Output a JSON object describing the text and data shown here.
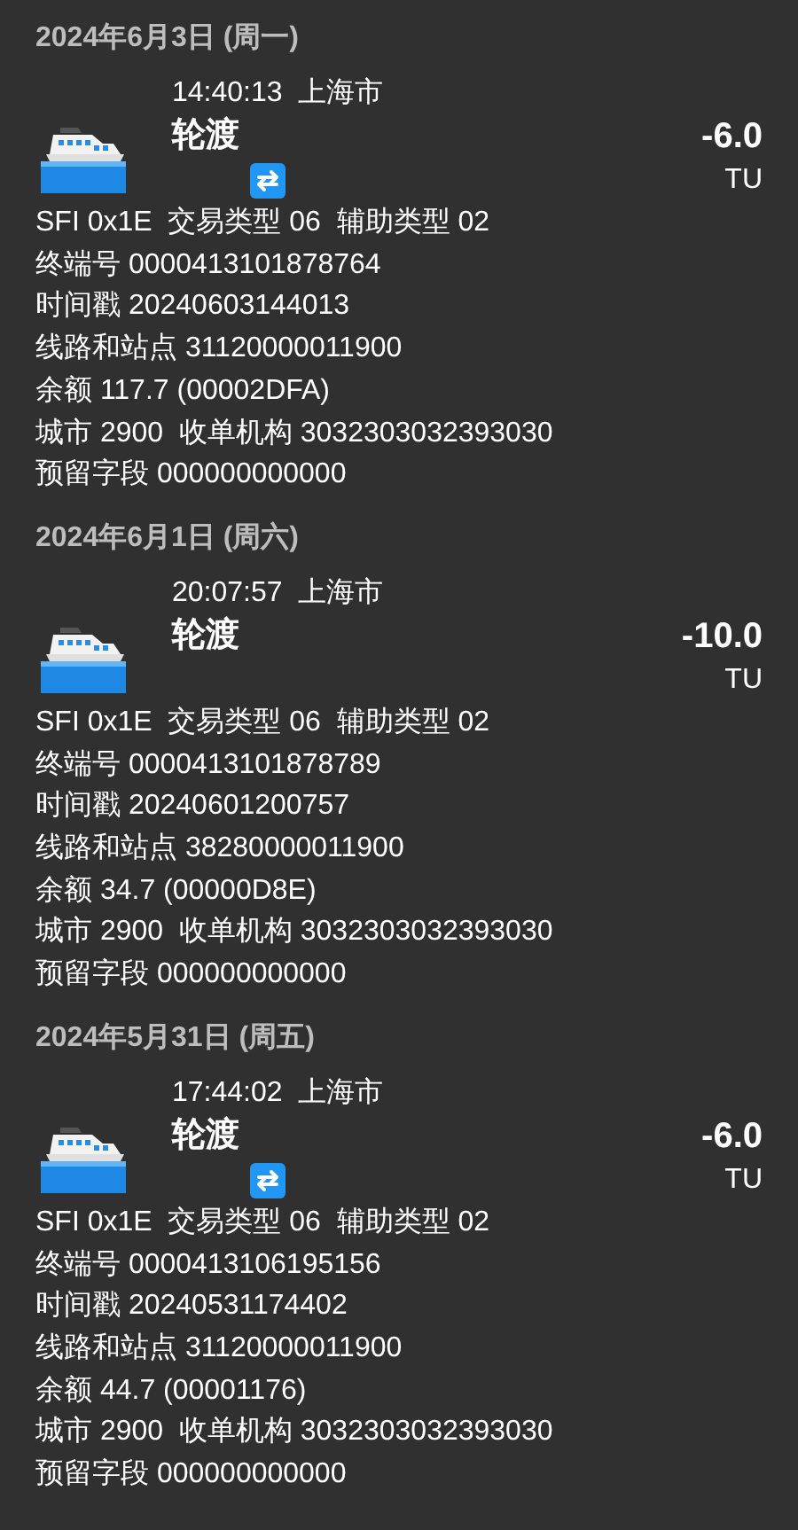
{
  "records": [
    {
      "date": "2024年6月3日 (周一)",
      "time": "14:40:13",
      "city": "上海市",
      "name": "轮渡",
      "transfer": true,
      "amount": "-6.0",
      "unit": "TU",
      "details": [
        "SFI 0x1E  交易类型 06  辅助类型 02",
        "终端号 0000413101878764",
        "时间戳 20240603144013",
        "线路和站点 31120000011900",
        "余额 117.7 (00002DFA)",
        "城市 2900  收单机构 3032303032393030",
        "预留字段 000000000000"
      ]
    },
    {
      "date": "2024年6月1日 (周六)",
      "time": "20:07:57",
      "city": "上海市",
      "name": "轮渡",
      "transfer": false,
      "amount": "-10.0",
      "unit": "TU",
      "details": [
        "SFI 0x1E  交易类型 06  辅助类型 02",
        "终端号 0000413101878789",
        "时间戳 20240601200757",
        "线路和站点 38280000011900",
        "余额 34.7 (00000D8E)",
        "城市 2900  收单机构 3032303032393030",
        "预留字段 000000000000"
      ]
    },
    {
      "date": "2024年5月31日 (周五)",
      "time": "17:44:02",
      "city": "上海市",
      "name": "轮渡",
      "transfer": true,
      "amount": "-6.0",
      "unit": "TU",
      "details": [
        "SFI 0x1E  交易类型 06  辅助类型 02",
        "终端号 0000413106195156",
        "时间戳 20240531174402",
        "线路和站点 31120000011900",
        "余额 44.7 (00001176)",
        "城市 2900  收单机构 3032303032393030",
        "预留字段 000000000000"
      ]
    }
  ]
}
